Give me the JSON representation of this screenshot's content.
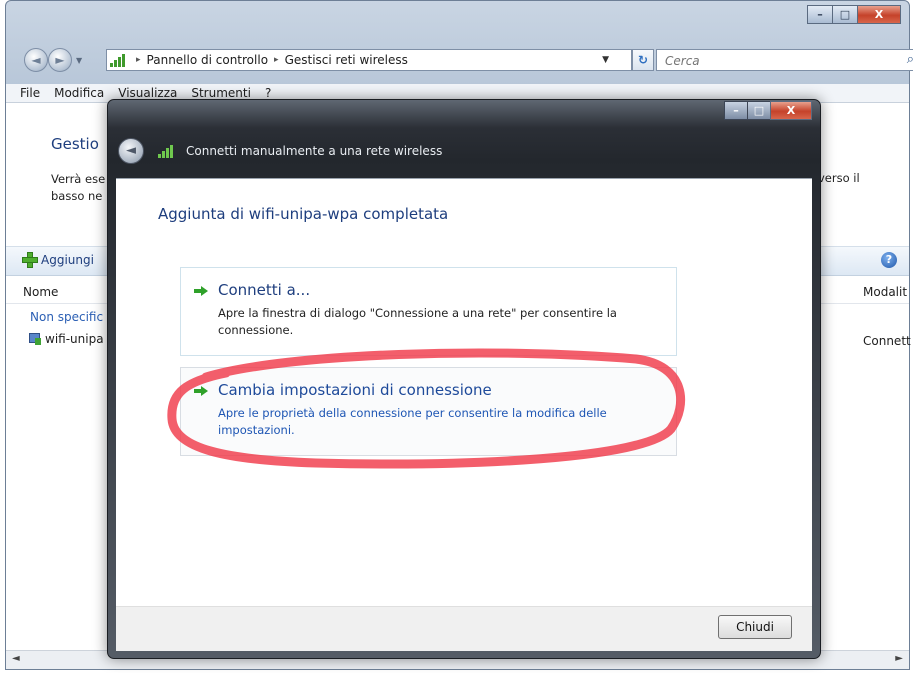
{
  "window": {
    "min_label": "–",
    "max_label": "□",
    "close_label": "X"
  },
  "nav": {
    "back_glyph": "◄",
    "fwd_glyph": "►",
    "drop_glyph": "▼",
    "breadcrumb": [
      "Pannello di controllo",
      "Gestisci reti wireless"
    ],
    "crumb_sep": "▸",
    "addr_drop": "▼",
    "refresh_glyph": "↻",
    "search_placeholder": "Cerca",
    "search_icon": "⌕"
  },
  "menu": [
    "File",
    "Modifica",
    "Visualizza",
    "Strumenti",
    "?"
  ],
  "main": {
    "heading": "Gestio",
    "desc_line1": "Verrà ese",
    "desc_line2": "basso ne",
    "desc_right": "verso il",
    "add_label": "Aggiungi",
    "help_glyph": "?",
    "col_name": "Nome",
    "col_mode": "Modalit",
    "group_label": "Non specific",
    "network_name": "wifi-unipa",
    "network_status": "Connett",
    "scroll_left": "◄",
    "scroll_right": "►"
  },
  "dialog": {
    "back_glyph": "◄",
    "title": "Connetti manualmente a una rete wireless",
    "heading": "Aggiunta di wifi-unipa-wpa completata",
    "options": [
      {
        "title": "Connetti a...",
        "text": "Apre la finestra di dialogo \"Connessione a una rete\" per consentire la connessione."
      },
      {
        "title": "Cambia impostazioni di connessione",
        "text": "Apre le proprietà della connessione per consentire la modifica delle impostazioni."
      }
    ],
    "close_button": "Chiudi"
  },
  "colors": {
    "link_blue": "#1e3e7e",
    "annotation_red": "#f03a4a",
    "arrow_green": "#2fa12a"
  }
}
